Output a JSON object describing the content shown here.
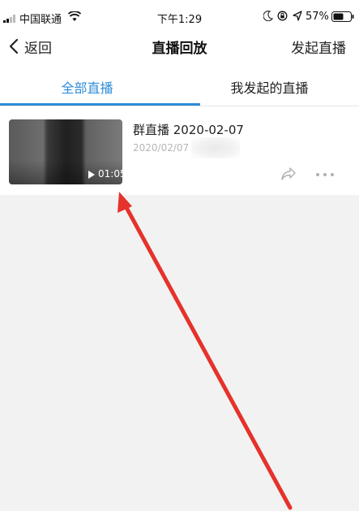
{
  "status_bar": {
    "carrier": "中国联通",
    "time": "下午1:29",
    "battery_percent": "57%",
    "icons": [
      "signal-icon",
      "wifi-icon",
      "moon-icon",
      "rotation-lock-icon",
      "location-arrow-icon",
      "battery-icon"
    ]
  },
  "nav": {
    "back_label": "返回",
    "title": "直播回放",
    "action_label": "发起直播",
    "back_icon": "chevron-left-icon"
  },
  "tabs": [
    {
      "label": "全部直播",
      "active": true
    },
    {
      "label": "我发起的直播",
      "active": false
    }
  ],
  "items": [
    {
      "title": "群直播 2020-02-07",
      "date": "2020/02/07",
      "duration": "01:05",
      "icons": [
        "play-icon",
        "share-icon",
        "more-icon"
      ]
    }
  ],
  "colors": {
    "accent": "#2e8bd7",
    "annotation_arrow": "#e5322b",
    "page_background": "#f2f2f2"
  }
}
